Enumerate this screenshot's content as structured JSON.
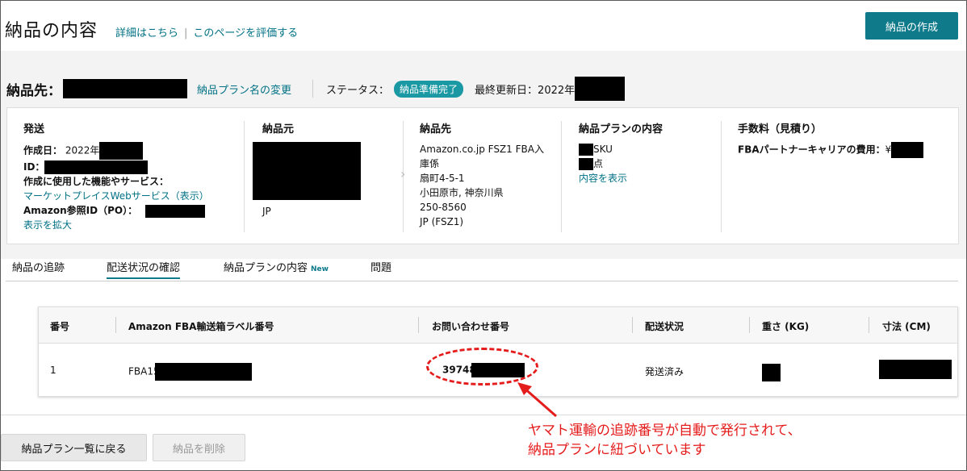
{
  "header": {
    "title": "納品の内容",
    "link_details": "詳細はこちら",
    "link_separator": "|",
    "link_rate": "このページを評価する",
    "create_button": "納品の作成"
  },
  "destination": {
    "label": "納品先：",
    "rename_link": "納品プラン名の変更",
    "status_label": "ステータス：",
    "status_value": "納品準備完了",
    "updated_label": "最終更新日：2022年"
  },
  "summary": {
    "ship": {
      "heading": "発送",
      "created_label": "作成日：",
      "created_value": "2022年",
      "id_label": "ID：",
      "service_label": "作成に使用した機能やサービス：",
      "service_link": "マーケットプレイスWebサービス（表示）",
      "po_label": "Amazon参照ID（PO）：",
      "expand_link": "表示を拡大"
    },
    "origin": {
      "heading": "納品元",
      "country": "JP"
    },
    "dest": {
      "heading": "納品先",
      "lines": [
        "Amazon.co.jp FSZ1 FBA入",
        "庫係",
        "扇町4-5-1",
        "小田原市, 神奈川県",
        "250-8560",
        "JP (FSZ1)"
      ]
    },
    "contents": {
      "heading": "納品プランの内容",
      "sku_suffix": "SKU",
      "unit_suffix": "点",
      "view_link": "内容を表示"
    },
    "fees": {
      "heading": "手数料（見積り）",
      "partner_label": "FBAパートナーキャリアの費用：",
      "currency": "¥"
    }
  },
  "tabs": [
    {
      "label": "納品の追跡"
    },
    {
      "label": "配送状況の確認"
    },
    {
      "label": "納品プランの内容",
      "badge": "New"
    },
    {
      "label": "問題"
    }
  ],
  "table": {
    "headers": [
      "番号",
      "Amazon FBA輸送箱ラベル番号",
      "お問い合わせ番号",
      "配送状況",
      "重さ (KG)",
      "寸法 (CM)"
    ],
    "row": {
      "number": "1",
      "label_prefix": "FBA15",
      "tracking_prefix": "39748",
      "status": "発送済み"
    }
  },
  "footer": {
    "back_button": "納品プラン一覧に戻る",
    "delete_button": "納品を削除"
  },
  "annotation": {
    "line1": "ヤマト運輸の追跡番号が自動で発行されて、",
    "line2": "納品プランに紐づいています",
    "color": "#e51c1c"
  }
}
